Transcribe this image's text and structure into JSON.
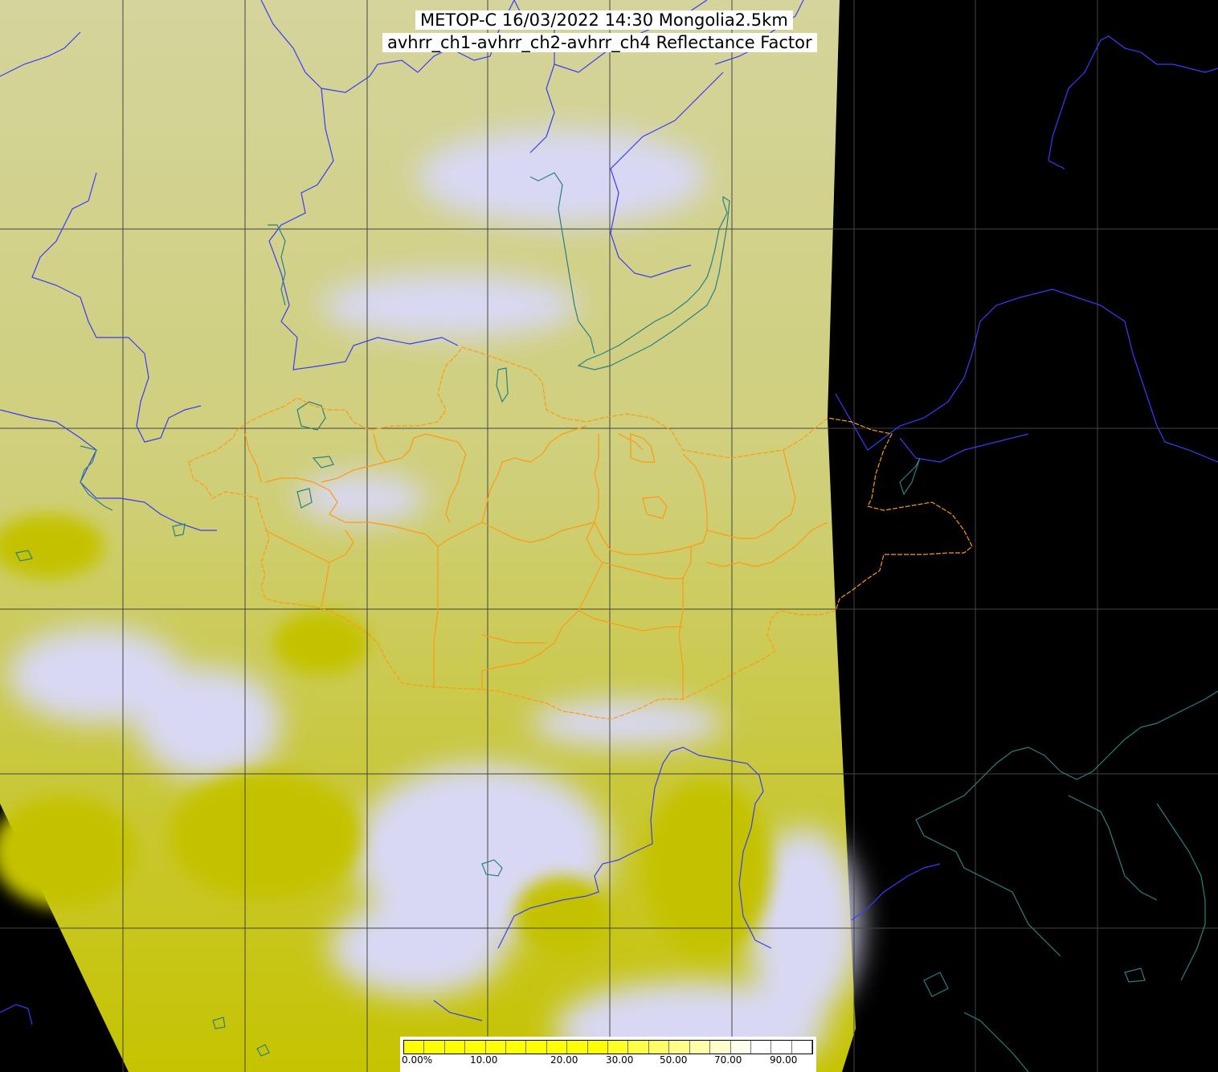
{
  "title": {
    "line1": "METOP-C 16/03/2022 14:30 Mongolia2.5km",
    "line2": "avhrr_ch1-avhrr_ch2-avhrr_ch4 Reflectance Factor"
  },
  "colorbar": {
    "labels": [
      "0.00%",
      "10.00",
      "20.00",
      "30.00",
      "50.00",
      "70.00",
      "90.00"
    ],
    "colors": [
      "#ffff00",
      "#ffff00",
      "#ffff00",
      "#ffff00",
      "#ffff00",
      "#ffff00",
      "#ffff00",
      "#ffff00",
      "#ffff00",
      "#ffff00",
      "#ffff22",
      "#ffff44",
      "#ffff66",
      "#ffff88",
      "#ffffaa",
      "#ffffcc",
      "#ffffee",
      "#ffffff",
      "#ffffff",
      "#ffffff"
    ]
  },
  "colors": {
    "background": "#000000",
    "swath": "#d0d08a",
    "cloud": "#d8d8f0",
    "surface": "#c8c400",
    "grid": "#444444",
    "country_border": "#3a3aff",
    "admin_border": "#ff9900",
    "water": "#1a6a6a",
    "coast_dark": "#2a7a7a"
  }
}
